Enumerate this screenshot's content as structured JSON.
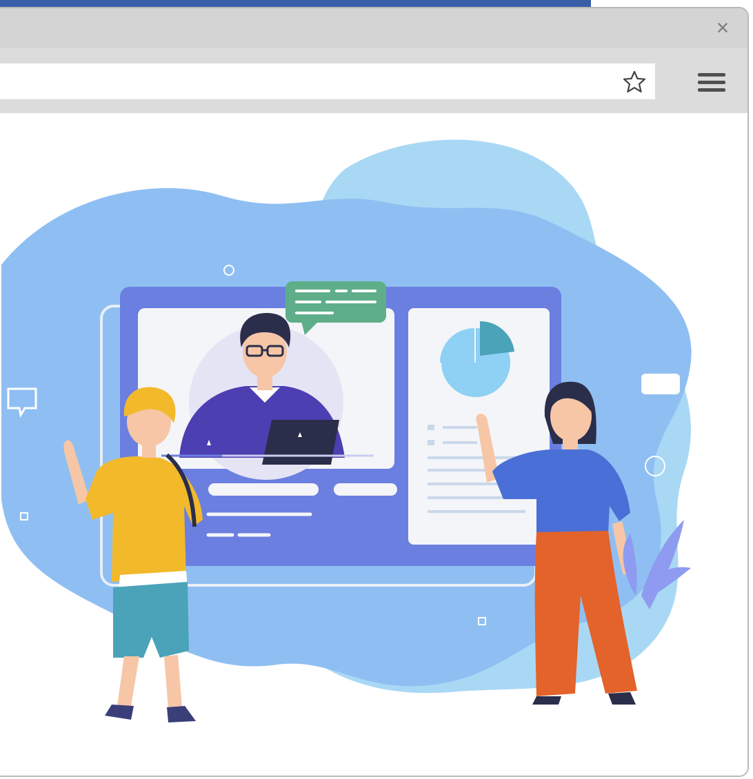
{
  "window": {
    "close_glyph": "×"
  },
  "toolbar": {
    "address_value": "",
    "star_icon": "star-icon",
    "menu_icon": "hamburger-menu-icon"
  },
  "illustration": {
    "description_icon": "online-learning-illustration",
    "colors": {
      "blob_back": "#a9d8f5",
      "blob_front": "#8fbff2",
      "monitor": "#6b7fe0",
      "panel": "#f4f5f8",
      "speech_bubble": "#5fae8a",
      "pie_main": "#8fd0f5",
      "pie_slice": "#4aa3b8",
      "boy_shirt": "#f2b92b",
      "boy_shorts": "#4aa3b8",
      "girl_shirt": "#4a6fd6",
      "girl_pants": "#e3632a",
      "teacher_sweater": "#4c3fb2",
      "hair_dark": "#2b2e4a",
      "skin": "#f6c6a6"
    }
  }
}
